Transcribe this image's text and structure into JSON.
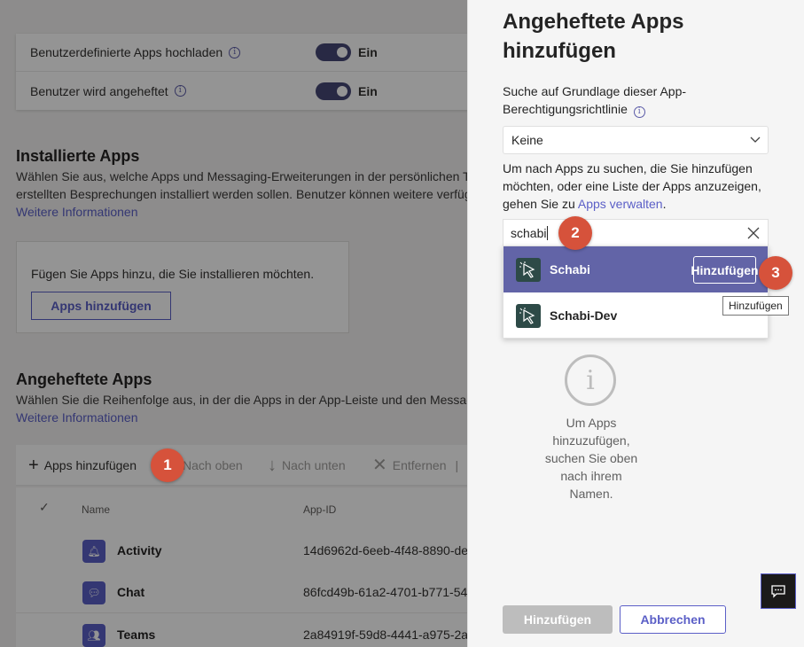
{
  "background": {
    "settings": [
      {
        "label": "Benutzerdefinierte Apps hochladen",
        "state": "Ein"
      },
      {
        "label": "Benutzer wird angeheftet",
        "state": "Ein"
      }
    ],
    "installed": {
      "title": "Installierte Apps",
      "desc_line1": "Wählen Sie aus, welche Apps und Messaging-Erweiterungen in der persönlichen Te",
      "desc_line2": "erstellten Besprechungen installiert werden sollen. Benutzer können weitere verfüg",
      "link": "Weitere Informationen",
      "box_text": "Fügen Sie Apps hinzu, die Sie installieren möchten.",
      "box_button": "Apps hinzufügen"
    },
    "pinned": {
      "title": "Angeheftete Apps",
      "desc_line1": "Wählen Sie die Reihenfolge aus, in der die Apps in der App-Leiste und den Messag",
      "link": "Weitere Informationen"
    },
    "toolbar": {
      "add": "Apps hinzufügen",
      "up": "Nach oben",
      "down": "Nach unten",
      "remove": "Entfernen"
    },
    "table": {
      "col_name": "Name",
      "col_id": "App-ID",
      "rows": [
        {
          "name": "Activity",
          "id": "14d6962d-6eeb-4f48-8890-de"
        },
        {
          "name": "Chat",
          "id": "86fcd49b-61a2-4701-b771-54"
        },
        {
          "name": "Teams",
          "id": "2a84919f-59d8-4441-a975-2a"
        }
      ]
    }
  },
  "panel": {
    "title": "Angeheftete Apps hinzufügen",
    "policy_label": "Suche auf Grundlage dieser App-Berechtigungsrichtlinie",
    "policy_value": "Keine",
    "help_text": "Um nach Apps zu suchen, die Sie hinzufügen möchten, oder eine Liste der Apps anzuzeigen, gehen Sie zu",
    "help_link": "Apps verwalten",
    "help_end": ".",
    "search_value": "schabi",
    "results": [
      {
        "name": "Schabi",
        "selected": true,
        "action": "Hinzufügen"
      },
      {
        "name": "Schabi-Dev",
        "selected": false
      }
    ],
    "tooltip": "Hinzufügen",
    "empty_text": "Um Apps hinzuzufügen, suchen Sie oben nach ihrem Namen.",
    "primary_button": "Hinzufügen",
    "secondary_button": "Abbrechen"
  },
  "steps": [
    "1",
    "2",
    "3"
  ],
  "colors": {
    "accent": "#5b5fc7",
    "selected_row": "#6264a7",
    "step_marker": "#d6523b",
    "toggle_on": "#464775"
  },
  "icons": [
    "info-icon",
    "plus-icon",
    "arrow-up-icon",
    "arrow-down-icon",
    "close-icon",
    "checkmark-icon",
    "chevron-down-icon",
    "app-cursor-icon",
    "feedback-icon"
  ]
}
